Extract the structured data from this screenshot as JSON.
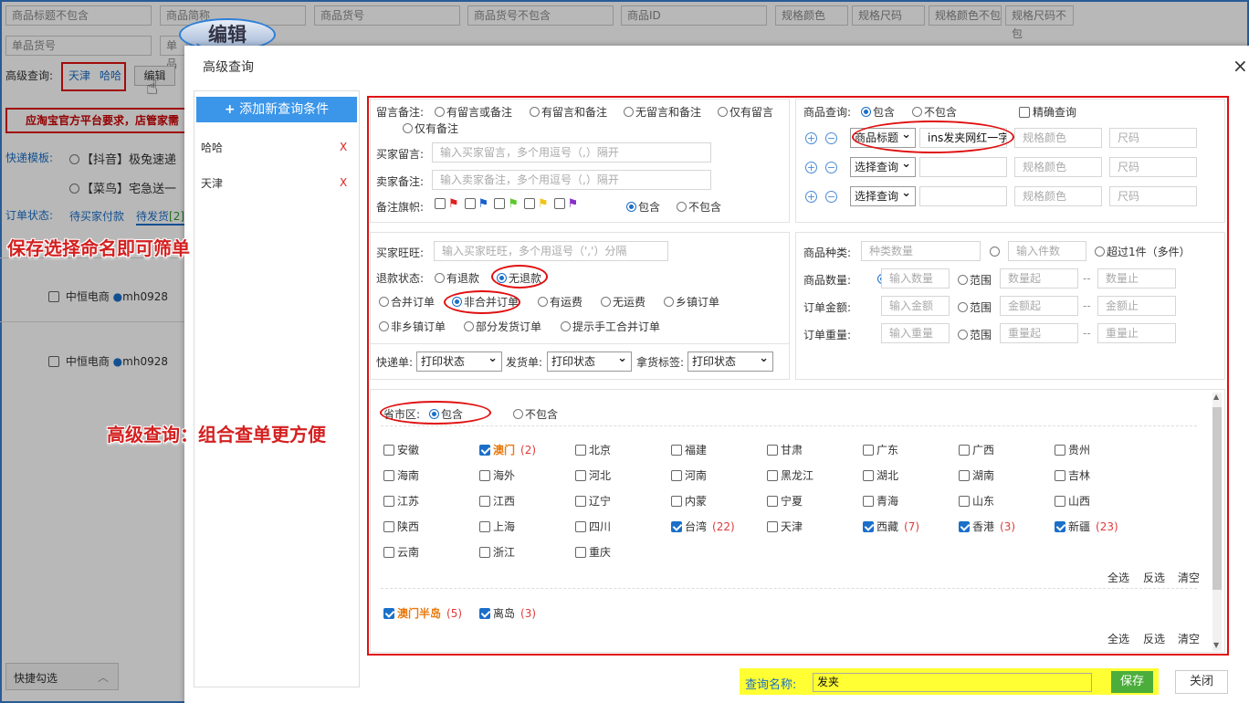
{
  "background": {
    "filters_row1": [
      "商品标题不包含",
      "商品简称",
      "商品货号",
      "商品货号不包含",
      "商品ID",
      "规格颜色",
      "规格尺码",
      "规格颜色不包",
      "规格尺码不包"
    ],
    "filters_row2": [
      "单品货号",
      "单品"
    ],
    "advanced_label": "高级查询:",
    "saved_queries": [
      "天津",
      "哈哈"
    ],
    "edit_button": "编辑",
    "callout_text": "编辑",
    "notice": "应淘宝官方平台要求，店管家需",
    "express_template_label": "快递模板:",
    "templates": [
      "【抖音】极兔速递",
      "【菜鸟】宅急送一"
    ],
    "order_status_label": "订单状态:",
    "status_tabs": [
      "待买家付款",
      "待发货"
    ],
    "status_count": "[2]",
    "rows": [
      {
        "shop": "中恒电商",
        "user": "mh0928"
      },
      {
        "shop": "中恒电商",
        "user": "mh0928"
      }
    ],
    "quick_select": "快捷勾选",
    "annotations": {
      "save": "保存选择命名即可筛单",
      "advanced": "高级查询：组合查单更方便"
    }
  },
  "modal": {
    "title": "高级查询",
    "close_icon": "×",
    "add_button": "添加新查询条件",
    "queries": [
      {
        "name": "哈哈",
        "delete": "X"
      },
      {
        "name": "天津",
        "delete": "X"
      }
    ],
    "memo": {
      "label": "留言备注:",
      "options": [
        "有留言或备注",
        "有留言和备注",
        "无留言和备注",
        "仅有留言",
        "仅有备注"
      ],
      "buyer_label": "买家留言:",
      "buyer_placeholder": "输入买家留言，多个用逗号（,）隔开",
      "seller_label": "卖家备注:",
      "seller_placeholder": "输入卖家备注，多个用逗号（,）隔开",
      "flag_label": "备注旗帜:",
      "flag_colors": [
        "#e02020",
        "#1a5fd0",
        "#5cc82e",
        "#f2c21a",
        "#8a2fc8"
      ],
      "include": "包含",
      "exclude": "不包含"
    },
    "product": {
      "label": "商品查询:",
      "include": "包含",
      "exclude": "不包含",
      "exact": "精确查询",
      "rows": [
        {
          "select": "商品标题",
          "value": "ins发夹网红一字",
          "color": "规格颜色",
          "size": "尺码"
        },
        {
          "select": "选择查询",
          "value": "",
          "color": "规格颜色",
          "size": "尺码"
        },
        {
          "select": "选择查询",
          "value": "",
          "color": "规格颜色",
          "size": "尺码"
        }
      ]
    },
    "buyer": {
      "wangwang_label": "买家旺旺:",
      "wangwang_placeholder": "输入买家旺旺，多个用逗号（','）分隔",
      "refund_label": "退款状态:",
      "refund_options": [
        "有退款",
        "无退款"
      ],
      "merge_options": [
        "合并订单",
        "非合并订单",
        "有运费",
        "无运费",
        "乡镇订单"
      ],
      "other_options": [
        "非乡镇订单",
        "部分发货订单",
        "提示手工合并订单"
      ],
      "express_label": "快递单:",
      "express_value": "打印状态",
      "ship_label": "发货单:",
      "ship_value": "打印状态",
      "pick_label": "拿货标签:",
      "pick_value": "打印状态"
    },
    "goods": {
      "kind_label": "商品种类:",
      "kind_placeholder": "种类数量",
      "count_placeholder": "输入件数",
      "over1": "超过1件（多件）",
      "qty_label": "商品数量:",
      "qty_input": "输入数量",
      "range": "范围",
      "qty_from": "数量起",
      "qty_to": "数量止",
      "amt_label": "订单金额:",
      "amt_input": "输入金额",
      "amt_from": "金额起",
      "amt_to": "金额止",
      "wt_label": "订单重量:",
      "wt_input": "输入重量",
      "wt_from": "重量起",
      "wt_to": "重量止",
      "dash": "--"
    },
    "region": {
      "label": "省市区:",
      "include": "包含",
      "exclude": "不包含",
      "provinces": [
        {
          "name": "安徽",
          "on": false,
          "count": ""
        },
        {
          "name": "澳门",
          "on": true,
          "count": "(2)",
          "orange": true
        },
        {
          "name": "北京",
          "on": false,
          "count": ""
        },
        {
          "name": "福建",
          "on": false,
          "count": ""
        },
        {
          "name": "甘肃",
          "on": false,
          "count": ""
        },
        {
          "name": "广东",
          "on": false,
          "count": ""
        },
        {
          "name": "广西",
          "on": false,
          "count": ""
        },
        {
          "name": "贵州",
          "on": false,
          "count": ""
        },
        {
          "name": "海南",
          "on": false,
          "count": ""
        },
        {
          "name": "海外",
          "on": false,
          "count": ""
        },
        {
          "name": "河北",
          "on": false,
          "count": ""
        },
        {
          "name": "河南",
          "on": false,
          "count": ""
        },
        {
          "name": "黑龙江",
          "on": false,
          "count": ""
        },
        {
          "name": "湖北",
          "on": false,
          "count": ""
        },
        {
          "name": "湖南",
          "on": false,
          "count": ""
        },
        {
          "name": "吉林",
          "on": false,
          "count": ""
        },
        {
          "name": "江苏",
          "on": false,
          "count": ""
        },
        {
          "name": "江西",
          "on": false,
          "count": ""
        },
        {
          "name": "辽宁",
          "on": false,
          "count": ""
        },
        {
          "name": "内蒙",
          "on": false,
          "count": ""
        },
        {
          "name": "宁夏",
          "on": false,
          "count": ""
        },
        {
          "name": "青海",
          "on": false,
          "count": ""
        },
        {
          "name": "山东",
          "on": false,
          "count": ""
        },
        {
          "name": "山西",
          "on": false,
          "count": ""
        },
        {
          "name": "陕西",
          "on": false,
          "count": ""
        },
        {
          "name": "上海",
          "on": false,
          "count": ""
        },
        {
          "name": "四川",
          "on": false,
          "count": ""
        },
        {
          "name": "台湾",
          "on": true,
          "count": "(22)"
        },
        {
          "name": "天津",
          "on": false,
          "count": ""
        },
        {
          "name": "西藏",
          "on": true,
          "count": "(7)"
        },
        {
          "name": "香港",
          "on": true,
          "count": "(3)"
        },
        {
          "name": "新疆",
          "on": true,
          "count": "(23)"
        },
        {
          "name": "云南",
          "on": false,
          "count": ""
        },
        {
          "name": "浙江",
          "on": false,
          "count": ""
        },
        {
          "name": "重庆",
          "on": false,
          "count": ""
        }
      ],
      "select_all": "全选",
      "invert": "反选",
      "clear": "清空",
      "sub_items": [
        {
          "name": "澳门半岛",
          "on": true,
          "count": "(5)",
          "orange": true
        },
        {
          "name": "离岛",
          "on": true,
          "count": "(3)"
        }
      ]
    },
    "footer": {
      "name_label": "查询名称:",
      "name_value": "发夹",
      "save": "保存",
      "close": "关闭"
    }
  }
}
